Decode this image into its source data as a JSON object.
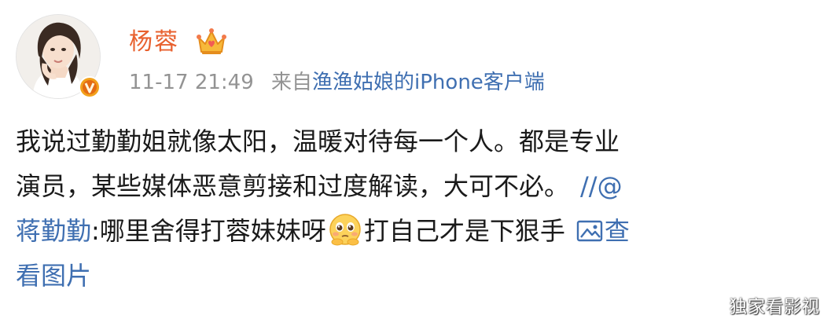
{
  "user": {
    "name": "杨蓉",
    "verified_badge": "v-badge-icon",
    "crown_badge": "crown-icon"
  },
  "meta": {
    "time": "11-17 21:49",
    "via": "来自",
    "source": "渔渔姑娘的iPhone客户端"
  },
  "post": {
    "line1": "我说过勤勤姐就像太阳，温暖对待每一个人。都是专业",
    "line2": "演员，某些媒体恶意剪接和过度解读，大可不必。",
    "repost_marker": "//@",
    "mention": "蒋勤勤",
    "quote_part1": ":哪里舍得打蓉妹妹呀",
    "emoji": "pleading-face-emoji",
    "quote_part2": "打自己才是下狠手",
    "view_image_part1": "查",
    "view_image_part2": "看图片"
  },
  "watermark": "独家看影视",
  "colors": {
    "name": "#e8612f",
    "link": "#3f6fb1",
    "meta": "#939393",
    "text": "#1a1a1a"
  }
}
